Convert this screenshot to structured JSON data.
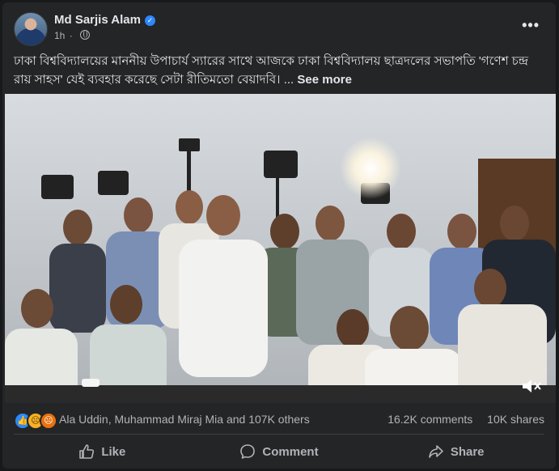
{
  "post": {
    "author": "Md Sarjis Alam",
    "time": "1h",
    "caption": "ঢাকা বিশ্ববিদ্যালয়ের মাননীয় উপাচার্য স্যারের সাথে আজকে ঢাকা বিশ্ববিদ্যালয় ছাত্রদলের সভাপতি 'গণেশ চন্দ্র রায় সাহস' যেই ব্যবহার করেছে সেটা রীতিমতো বেয়াদবি। ...",
    "see_more": "See more"
  },
  "reactions": {
    "icons": [
      "like-icon",
      "sad-icon",
      "angry-icon"
    ],
    "names": "Ala Uddin, Muhammad Miraj Mia and 107K others",
    "comments": "16.2K comments",
    "shares": "10K shares"
  },
  "actions": {
    "like": "Like",
    "comment": "Comment",
    "share": "Share"
  },
  "colors": {
    "background": "#18191a",
    "card": "#242526",
    "text": "#e4e6eb",
    "secondary": "#b0b3b8",
    "verified": "#2d88ff"
  }
}
